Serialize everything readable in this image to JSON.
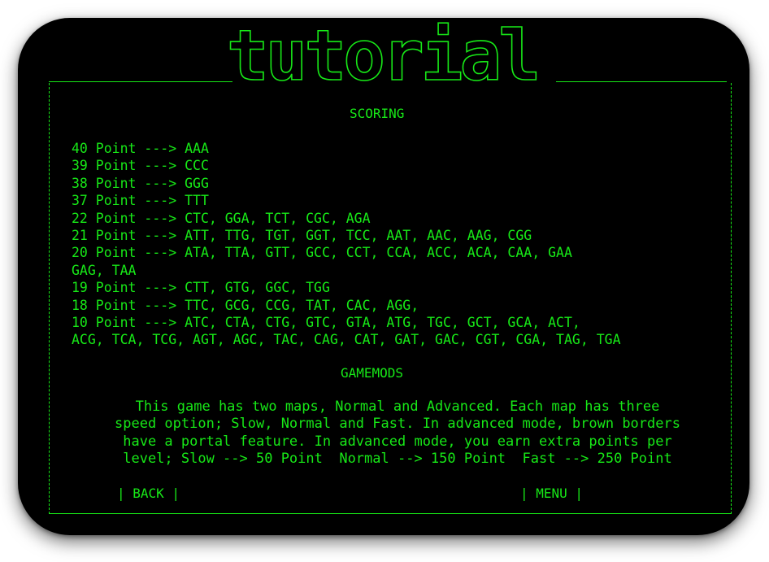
{
  "banner": {
    "word": "tutorial"
  },
  "scoring": {
    "title": "SCORING",
    "lines": [
      "40 Point ---> AAA",
      "39 Point ---> CCC",
      "38 Point ---> GGG",
      "37 Point ---> TTT",
      "22 Point ---> CTC, GGA, TCT, CGC, AGA",
      "21 Point ---> ATT, TTG, TGT, GGT, TCC, AAT, AAC, AAG, CGG",
      "20 Point ---> ATA, TTA, GTT, GCC, CCT, CCA, ACC, ACA, CAA, GAA",
      "GAG, TAA",
      "19 Point ---> CTT, GTG, GGC, TGG",
      "18 Point ---> TTC, GCG, CCG, TAT, CAC, AGG,",
      "10 Point ---> ATC, CTA, CTG, GTC, GTA, ATG, TGC, GCT, GCA, ACT,",
      "ACG, TCA, TCG, AGT, AGC, TAC, CAG, CAT, GAT, GAC, CGT, CGA, TAG, TGA"
    ]
  },
  "gamemods": {
    "title": "GAMEMODS",
    "lines": [
      "This game has two maps, Normal and Advanced. Each map has three",
      "speed option; Slow, Normal and Fast. In advanced mode, brown borders",
      "have a portal feature. In advanced mode, you earn extra points per",
      "level; Slow --> 50 Point  Normal --> 150 Point  Fast --> 250 Point"
    ]
  },
  "buttons": {
    "back": "| BACK |",
    "menu": "| MENU |"
  },
  "colors": {
    "text": "#17e817",
    "background": "#000000"
  }
}
